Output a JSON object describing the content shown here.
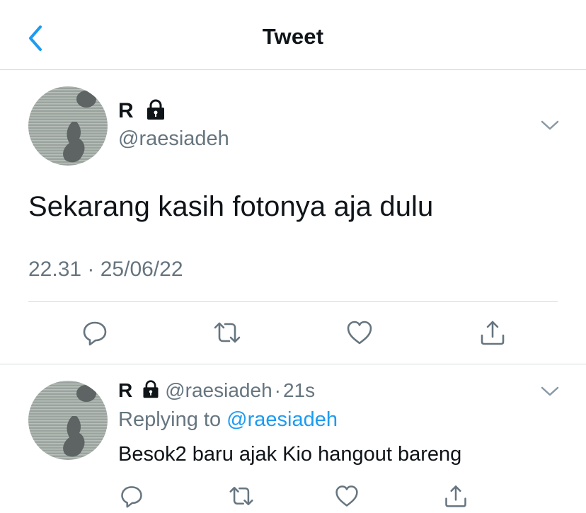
{
  "header": {
    "title": "Tweet",
    "back_icon": "chevron-left-icon"
  },
  "main_tweet": {
    "author_name": "R",
    "author_handle": "@raesiadeh",
    "protected_icon": "lock-icon",
    "text": "Sekarang kasih fotonya aja dulu",
    "timestamp": "22.31 · 25/06/22",
    "actions": [
      "reply-icon",
      "retweet-icon",
      "like-icon",
      "share-icon"
    ]
  },
  "reply_tweet": {
    "author_name": "R",
    "author_handle": "@raesiadeh",
    "separator": "·",
    "time_ago": "21s",
    "replying_prefix": "Replying to",
    "replying_to": "@raesiadeh",
    "text": "Besok2 baru ajak Kio hangout bareng",
    "actions": [
      "reply-icon",
      "retweet-icon",
      "like-icon",
      "share-icon"
    ]
  },
  "colors": {
    "accent": "#1d9bf0",
    "secondary_text": "#66757f",
    "primary_text": "#0f1419",
    "divider": "#d6d9db"
  }
}
